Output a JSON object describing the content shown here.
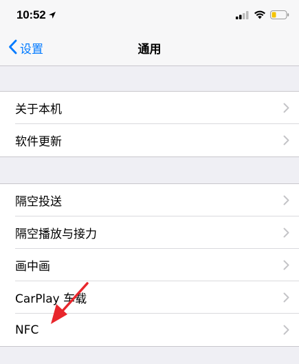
{
  "status_bar": {
    "time": "10:52",
    "icons": [
      "location-arrow-icon",
      "cellular-signal-icon",
      "wifi-icon",
      "battery-low-icon"
    ]
  },
  "nav": {
    "back_label": "设置",
    "title": "通用"
  },
  "groups": [
    {
      "items": [
        {
          "label": "关于本机"
        },
        {
          "label": "软件更新"
        }
      ]
    },
    {
      "items": [
        {
          "label": "隔空投送"
        },
        {
          "label": "隔空播放与接力"
        },
        {
          "label": "画中画"
        },
        {
          "label": "CarPlay 车载"
        },
        {
          "label": "NFC"
        }
      ]
    }
  ],
  "colors": {
    "accent": "#007aff",
    "battery": "#f5c400",
    "annotation_arrow": "#e8262c",
    "chevron": "#c4c4c7"
  }
}
